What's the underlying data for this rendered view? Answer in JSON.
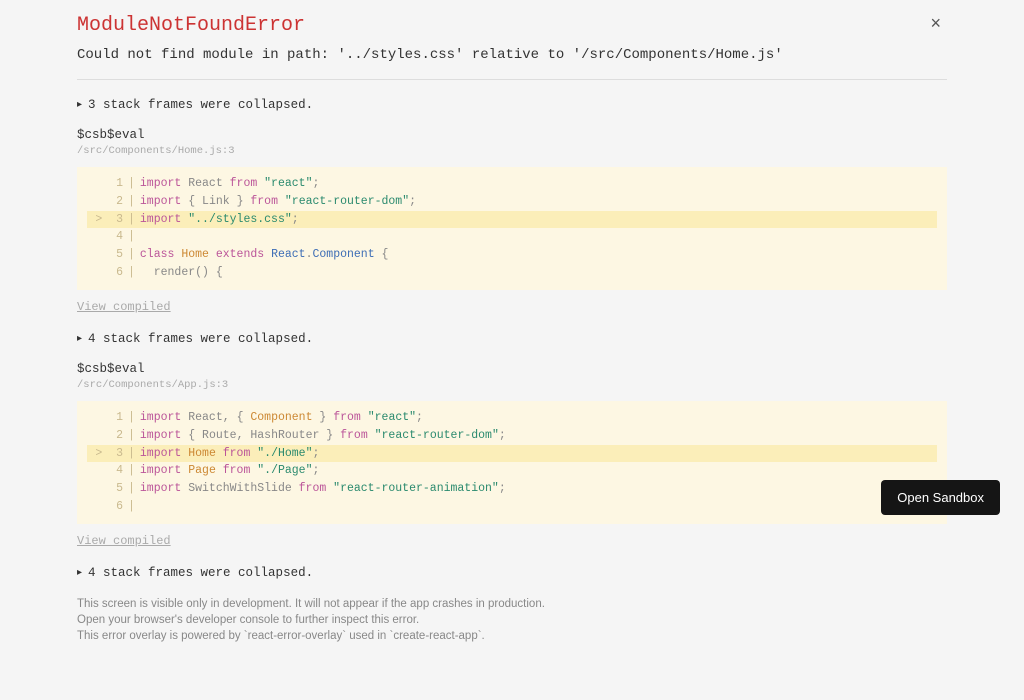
{
  "error": {
    "title": "ModuleNotFoundError",
    "message": "Could not find module in path: '../styles.css' relative to '/src/Components/Home.js'"
  },
  "close_label": "×",
  "frames": [
    {
      "collapse_label": "3 stack frames were collapsed.",
      "label": "$csb$eval",
      "path": "/src/Components/Home.js:3",
      "view_compiled": "View compiled",
      "code": {
        "lines": [
          {
            "n": "   1",
            "hl": false,
            "tokens": [
              [
                "kw",
                "import"
              ],
              [
                "fn",
                " React "
              ],
              [
                "kw",
                "from"
              ],
              [
                "fn",
                " "
              ],
              [
                "str",
                "\"react\""
              ],
              [
                "pun",
                ";"
              ]
            ]
          },
          {
            "n": "   2",
            "hl": false,
            "tokens": [
              [
                "kw",
                "import"
              ],
              [
                "fn",
                " "
              ],
              [
                "pun",
                "{"
              ],
              [
                "fn",
                " Link "
              ],
              [
                "pun",
                "}"
              ],
              [
                "fn",
                " "
              ],
              [
                "kw",
                "from"
              ],
              [
                "fn",
                " "
              ],
              [
                "str",
                "\"react-router-dom\""
              ],
              [
                "pun",
                ";"
              ]
            ]
          },
          {
            "n": ">  3",
            "hl": true,
            "tokens": [
              [
                "kw",
                "import"
              ],
              [
                "fn",
                " "
              ],
              [
                "str",
                "\"../styles.css\""
              ],
              [
                "pun",
                ";"
              ]
            ]
          },
          {
            "n": "   4",
            "hl": false,
            "tokens": []
          },
          {
            "n": "   5",
            "hl": false,
            "tokens": [
              [
                "kw",
                "class"
              ],
              [
                "fn",
                " "
              ],
              [
                "cls",
                "Home"
              ],
              [
                "fn",
                " "
              ],
              [
                "kw",
                "extends"
              ],
              [
                "fn",
                " "
              ],
              [
                "id",
                "React"
              ],
              [
                "pun",
                "."
              ],
              [
                "id",
                "Component"
              ],
              [
                "fn",
                " "
              ],
              [
                "pun",
                "{"
              ]
            ]
          },
          {
            "n": "   6",
            "hl": false,
            "tokens": [
              [
                "fn",
                "  "
              ],
              [
                "fn",
                "render"
              ],
              [
                "pun",
                "()"
              ],
              [
                "fn",
                " "
              ],
              [
                "pun",
                "{"
              ]
            ]
          }
        ]
      }
    },
    {
      "collapse_label": "4 stack frames were collapsed.",
      "label": "$csb$eval",
      "path": "/src/Components/App.js:3",
      "view_compiled": "View compiled",
      "code": {
        "lines": [
          {
            "n": "   1",
            "hl": false,
            "tokens": [
              [
                "kw",
                "import"
              ],
              [
                "fn",
                " React"
              ],
              [
                "pun",
                ","
              ],
              [
                "fn",
                " "
              ],
              [
                "pun",
                "{"
              ],
              [
                "fn",
                " "
              ],
              [
                "cls",
                "Component"
              ],
              [
                "fn",
                " "
              ],
              [
                "pun",
                "}"
              ],
              [
                "fn",
                " "
              ],
              [
                "kw",
                "from"
              ],
              [
                "fn",
                " "
              ],
              [
                "str",
                "\"react\""
              ],
              [
                "pun",
                ";"
              ]
            ]
          },
          {
            "n": "   2",
            "hl": false,
            "tokens": [
              [
                "kw",
                "import"
              ],
              [
                "fn",
                " "
              ],
              [
                "pun",
                "{"
              ],
              [
                "fn",
                " Route"
              ],
              [
                "pun",
                ","
              ],
              [
                "fn",
                " HashRouter "
              ],
              [
                "pun",
                "}"
              ],
              [
                "fn",
                " "
              ],
              [
                "kw",
                "from"
              ],
              [
                "fn",
                " "
              ],
              [
                "str",
                "\"react-router-dom\""
              ],
              [
                "pun",
                ";"
              ]
            ]
          },
          {
            "n": ">  3",
            "hl": true,
            "tokens": [
              [
                "kw",
                "import"
              ],
              [
                "fn",
                " "
              ],
              [
                "cls",
                "Home"
              ],
              [
                "fn",
                " "
              ],
              [
                "kw",
                "from"
              ],
              [
                "fn",
                " "
              ],
              [
                "str",
                "\"./Home\""
              ],
              [
                "pun",
                ";"
              ]
            ]
          },
          {
            "n": "   4",
            "hl": false,
            "tokens": [
              [
                "kw",
                "import"
              ],
              [
                "fn",
                " "
              ],
              [
                "cls",
                "Page"
              ],
              [
                "fn",
                " "
              ],
              [
                "kw",
                "from"
              ],
              [
                "fn",
                " "
              ],
              [
                "str",
                "\"./Page\""
              ],
              [
                "pun",
                ";"
              ]
            ]
          },
          {
            "n": "   5",
            "hl": false,
            "tokens": [
              [
                "kw",
                "import"
              ],
              [
                "fn",
                " SwitchWithSlide "
              ],
              [
                "kw",
                "from"
              ],
              [
                "fn",
                " "
              ],
              [
                "str",
                "\"react-router-animation\""
              ],
              [
                "pun",
                ";"
              ]
            ]
          },
          {
            "n": "   6",
            "hl": false,
            "tokens": []
          }
        ]
      }
    }
  ],
  "trailing_collapse": "4 stack frames were collapsed.",
  "dev_notes": [
    "This screen is visible only in development. It will not appear if the app crashes in production.",
    "Open your browser's developer console to further inspect this error.",
    "This error overlay is powered by `react-error-overlay` used in `create-react-app`."
  ],
  "open_sandbox_label": "Open Sandbox"
}
